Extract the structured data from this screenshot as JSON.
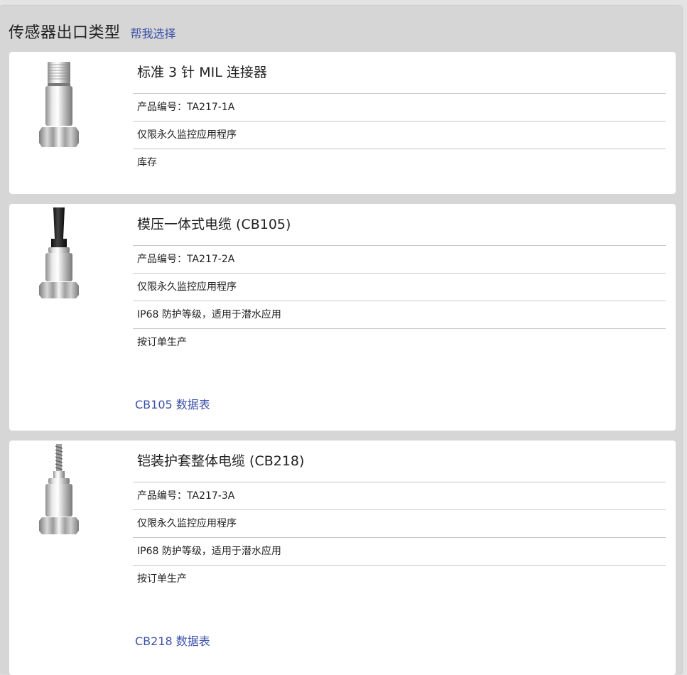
{
  "header": {
    "title": "传感器出口类型",
    "help_link": "帮我选择"
  },
  "products": [
    {
      "title": "标准 3 针 MIL 连接器",
      "details": [
        "产品编号：TA217-1A",
        "仅限永久监控应用程序",
        "库存"
      ],
      "image": "mil-connector-sensor-icon"
    },
    {
      "title": "模压一体式电缆 (CB105)",
      "details": [
        "产品编号：TA217-2A",
        "仅限永久监控应用程序",
        "IP68 防护等级，适用于潜水应用",
        "按订单生产"
      ],
      "datasheet": "CB105 数据表",
      "image": "molded-cable-sensor-icon"
    },
    {
      "title": "铠装护套整体电缆 (CB218)",
      "details": [
        "产品编号：TA217-3A",
        "仅限永久监控应用程序",
        "IP68 防护等级，适用于潜水应用",
        "按订单生产"
      ],
      "datasheet": "CB218 数据表",
      "image": "armored-cable-sensor-icon"
    }
  ],
  "colors": {
    "link": "#3b52a8",
    "panel": "#d6d6d6",
    "card": "#ffffff"
  }
}
